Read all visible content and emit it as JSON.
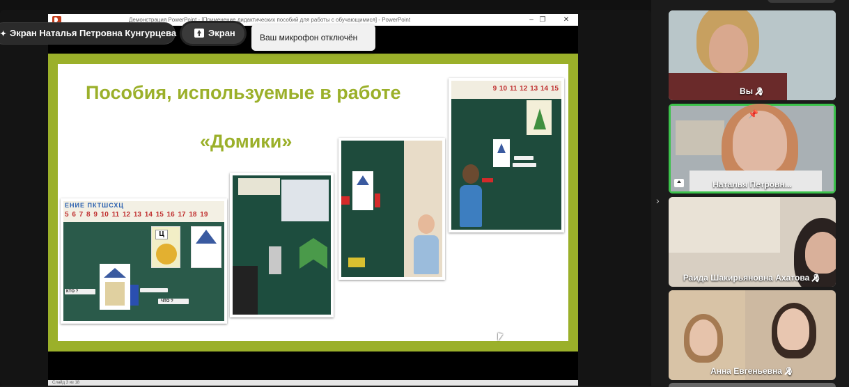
{
  "presentation": {
    "window_title": "Демонстрация PowerPoint - [Применение дидактических пособий для работы с обучающимися] - PowerPoint",
    "slide_title": "Пособия, используемые в работе",
    "slide_subtitle": "«Домики»",
    "status_text": "Слайд 3 из 18",
    "accent_color": "#9bb02a"
  },
  "overlay": {
    "presenter_label": "Экран Наталья Петровна Кунгурцева",
    "screen_button": "Экран",
    "mic_tooltip": "Ваш микрофон отключён"
  },
  "photo_text": {
    "letters": "ЕНИЕ  ПКТШСХЦ",
    "numbers": "5 6 7 8 9 10 11 12 13 14 15 16 17 18 19",
    "card_letter": "Ц",
    "who_label": "КТО ?",
    "what_label": "ЧТО ?",
    "top_numbers": "9 10 11 12 13 14 15"
  },
  "participants": [
    {
      "name": "Вы",
      "muted": true
    },
    {
      "name": "Наталья Петровн...",
      "muted": false,
      "active": true,
      "sharing": true,
      "pinned": true
    },
    {
      "name": "Раида Шакирьяновна Ахатова",
      "muted": true
    },
    {
      "name": "Анна Евгеньевна",
      "muted": true
    }
  ],
  "icons": {
    "collapse": "chevron-right-icon",
    "share": "screen-share-icon",
    "pin": "pin-icon",
    "mic": "mic-off-icon"
  }
}
